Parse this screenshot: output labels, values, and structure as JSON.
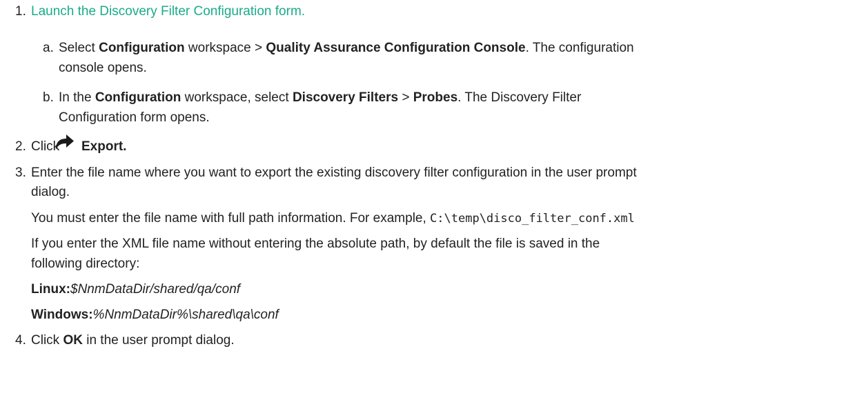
{
  "step1": {
    "number": "1.",
    "link_text": "Launch the Discovery Filter Configuration form.",
    "a": {
      "label": "a.",
      "t1": "Select ",
      "b1": "Configuration",
      "t2": " workspace > ",
      "b2": "Quality Assurance Configuration Console",
      "t3": ". The configuration",
      "t4": "console opens."
    },
    "b": {
      "label": "b.",
      "t1": "In the ",
      "b1": "Configuration",
      "t2": " workspace, select ",
      "b2": "Discovery Filters",
      "t3": " > ",
      "b3": "Probes",
      "t4": ". The Discovery Filter",
      "t5": "Configuration form opens."
    }
  },
  "step2": {
    "number": "2.",
    "t1": "Click",
    "icon": "export-arrow-icon",
    "b1": "Export."
  },
  "step3": {
    "number": "3.",
    "l1": "Enter the file name where you want to export the existing discovery filter configuration in the user prompt",
    "l2": "dialog.",
    "p1_text": "You must enter the file name with full path information. For example, ",
    "p1_code": "C:\\temp\\disco_filter_conf.xml",
    "p2_l1": "If you enter the XML file name without entering the absolute path, by default the file is saved in the",
    "p2_l2": "following directory:",
    "linux_label": "Linux:",
    "linux_path": "$NnmDataDir/shared/qa/conf",
    "windows_label": "Windows:",
    "windows_path": "%NnmDataDir%\\shared\\qa\\conf"
  },
  "step4": {
    "number": "4.",
    "t1": "Click ",
    "b1": "OK",
    "t2": " in the user prompt dialog."
  },
  "colors": {
    "link": "#1aab8a",
    "text": "#222222",
    "icon": "#1a1a1a"
  }
}
